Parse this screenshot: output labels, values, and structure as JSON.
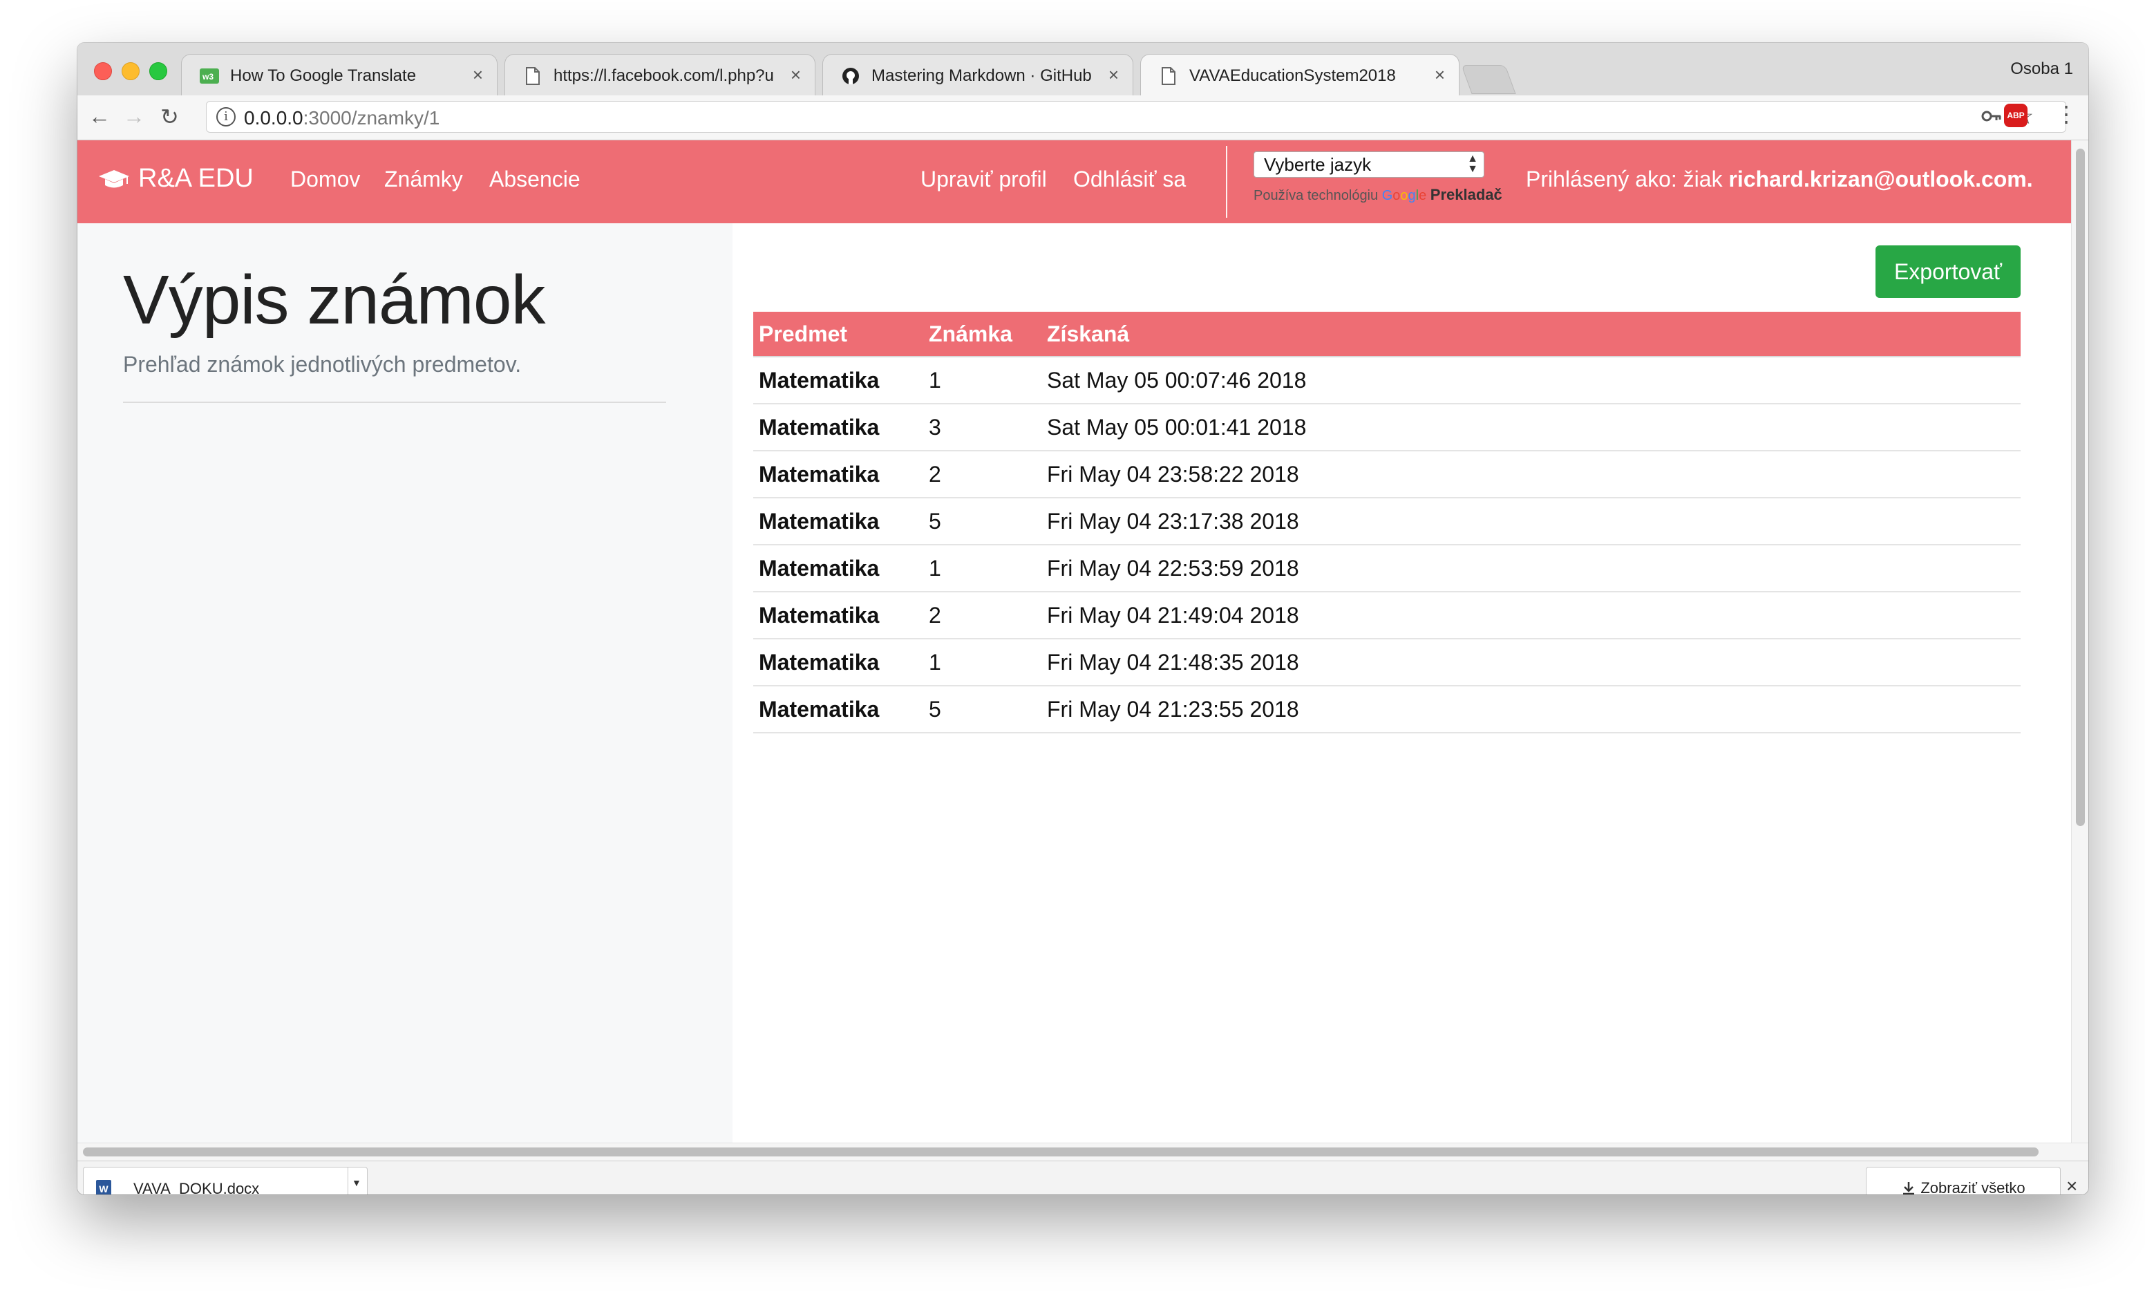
{
  "browser": {
    "tabs": [
      {
        "title": "How To Google Translate",
        "icon": "w3schools-icon"
      },
      {
        "title": "https://l.facebook.com/l.php?u",
        "icon": "page-icon"
      },
      {
        "title": "Mastering Markdown · GitHub",
        "icon": "github-icon"
      },
      {
        "title": "VAVAEducationSystem2018",
        "icon": "page-icon",
        "active": true
      }
    ],
    "tab_close": "×",
    "profile": "Osoba 1",
    "url_host": "0.0.0.0",
    "url_path": ":3000/znamky/1",
    "icons": {
      "back": "←",
      "forward": "→",
      "reload": "↻",
      "key": "🔑",
      "star": "☆",
      "menu": "⋮",
      "abp": "ABP"
    }
  },
  "app": {
    "brand": "R&A EDU",
    "nav": {
      "home": "Domov",
      "grades": "Známky",
      "absences": "Absencie",
      "edit_profile": "Upraviť profil",
      "logout": "Odhlásiť sa"
    },
    "translate": {
      "select_value": "Vyberte jazyk",
      "powered_by": "Používa technológiu",
      "google_g": "G",
      "google_o1": "o",
      "google_o2": "o",
      "google_g2": "g",
      "google_l": "l",
      "google_e": "e",
      "translator": "Prekladač"
    },
    "login_prefix": "Prihlásený ako: žiak",
    "login_email": "richard.krizan@outlook.com.",
    "accent_color": "#ee6d74",
    "success_color": "#28a745"
  },
  "sidebar": {
    "title": "Výpis známok",
    "lead": "Prehľad známok jednotlivých predmetov."
  },
  "main": {
    "export_label": "Exportovať",
    "columns": [
      "Predmet",
      "Známka",
      "Získaná"
    ],
    "rows": [
      {
        "subject": "Matematika",
        "grade": "1",
        "date": "Sat May 05 00:07:46 2018"
      },
      {
        "subject": "Matematika",
        "grade": "3",
        "date": "Sat May 05 00:01:41 2018"
      },
      {
        "subject": "Matematika",
        "grade": "2",
        "date": "Fri May 04 23:58:22 2018"
      },
      {
        "subject": "Matematika",
        "grade": "5",
        "date": "Fri May 04 23:17:38 2018"
      },
      {
        "subject": "Matematika",
        "grade": "1",
        "date": "Fri May 04 22:53:59 2018"
      },
      {
        "subject": "Matematika",
        "grade": "2",
        "date": "Fri May 04 21:49:04 2018"
      },
      {
        "subject": "Matematika",
        "grade": "1",
        "date": "Fri May 04 21:48:35 2018"
      },
      {
        "subject": "Matematika",
        "grade": "5",
        "date": "Fri May 04 21:23:55 2018"
      }
    ]
  },
  "downloads": {
    "file": "VAVA_DOKU.docx",
    "file_icon": "W",
    "show_all": "Zobraziť všetko",
    "close": "×"
  }
}
